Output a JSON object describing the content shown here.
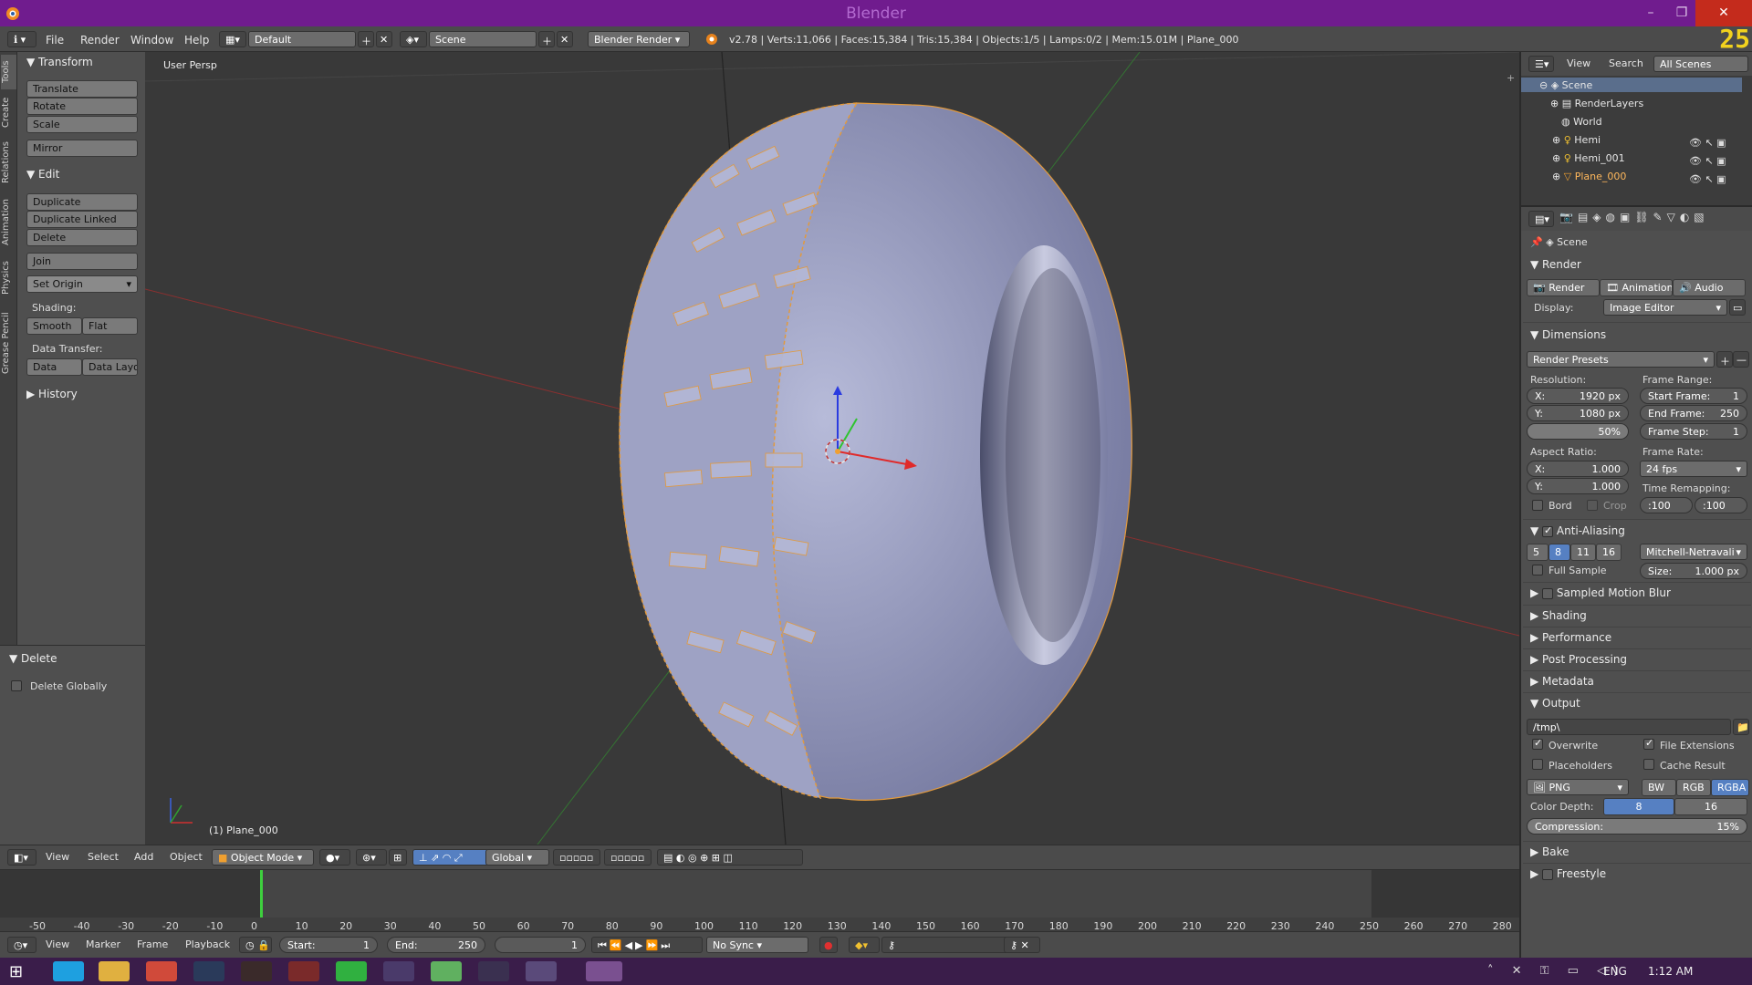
{
  "window": {
    "title": "Blender",
    "minimize": "–",
    "maximize": "❐",
    "close": "✕"
  },
  "info_bar": {
    "menus": [
      "File",
      "Render",
      "Window",
      "Help"
    ],
    "layout": "Default",
    "scene": "Scene",
    "engine": "Blender Render",
    "stats": "v2.78 | Verts:11,066 | Faces:15,384 | Tris:15,384 | Objects:1/5 | Lamps:0/2 | Mem:15.01M | Plane_000"
  },
  "corner_text": "25",
  "left_tabs": [
    "Tools",
    "Create",
    "Relations",
    "Animation",
    "Physics",
    "Grease Pencil"
  ],
  "tool_shelf": {
    "transform": {
      "title": "Transform",
      "buttons": [
        "Translate",
        "Rotate",
        "Scale",
        "Mirror"
      ]
    },
    "edit": {
      "title": "Edit",
      "buttons": [
        "Duplicate",
        "Duplicate Linked",
        "Delete",
        "Join"
      ],
      "set_origin": "Set Origin",
      "shading_label": "Shading:",
      "smooth": "Smooth",
      "flat": "Flat",
      "data_transfer_label": "Data Transfer:",
      "data": "Data",
      "data_layout": "Data Layo"
    },
    "history": "History"
  },
  "operator_panel": {
    "title": "Delete",
    "option": "Delete Globally"
  },
  "viewport": {
    "view_name": "User Persp",
    "object_label": "(1) Plane_000"
  },
  "view3d_header": {
    "menus": [
      "View",
      "Select",
      "Add",
      "Object"
    ],
    "mode": "Object Mode",
    "orientation": "Global"
  },
  "timeline": {
    "ticks": [
      "-50",
      "-40",
      "-30",
      "-20",
      "-10",
      "0",
      "10",
      "20",
      "30",
      "40",
      "50",
      "60",
      "70",
      "80",
      "90",
      "100",
      "110",
      "120",
      "130",
      "140",
      "150",
      "160",
      "170",
      "180",
      "190",
      "200",
      "210",
      "220",
      "230",
      "240",
      "250",
      "260",
      "270",
      "280"
    ],
    "current_frame": 1
  },
  "timeline_header": {
    "menus": [
      "View",
      "Marker",
      "Frame",
      "Playback"
    ],
    "start": "Start:",
    "start_val": "1",
    "end": "End:",
    "end_val": "250",
    "current": "1",
    "sync": "No Sync"
  },
  "outliner": {
    "menus": [
      "View",
      "Search"
    ],
    "filter": "All Scenes",
    "items": [
      "Scene",
      "RenderLayers",
      "World",
      "Hemi",
      "Hemi_001",
      "Plane_000"
    ]
  },
  "properties": {
    "context": "Scene",
    "render": {
      "title": "Render",
      "render_btn": "Render",
      "animation_btn": "Animation",
      "audio_btn": "Audio",
      "display_label": "Display:",
      "display": "Image Editor"
    },
    "dimensions": {
      "title": "Dimensions",
      "presets": "Render Presets",
      "resolution_label": "Resolution:",
      "res_x": "X:",
      "res_x_val": "1920 px",
      "res_y": "Y:",
      "res_y_val": "1080 px",
      "res_pct": "50%",
      "frame_range_label": "Frame Range:",
      "start_frame": "Start Frame:",
      "start_frame_val": "1",
      "end_frame": "End Frame:",
      "end_frame_val": "250",
      "frame_step": "Frame Step:",
      "frame_step_val": "1",
      "aspect_label": "Aspect Ratio:",
      "asp_x": "X:",
      "asp_x_val": "1.000",
      "asp_y": "Y:",
      "asp_y_val": "1.000",
      "frame_rate_label": "Frame Rate:",
      "frame_rate": "24 fps",
      "time_remap_label": "Time Remapping:",
      "remap_old": ":100",
      "remap_new": ":100",
      "border": "Bord",
      "crop": "Crop"
    },
    "anti_aliasing": {
      "title": "Anti-Aliasing",
      "samples": [
        "5",
        "8",
        "11",
        "16"
      ],
      "filter": "Mitchell-Netravali",
      "full_sample": "Full Sample",
      "size": "Size:",
      "size_val": "1.000 px"
    },
    "collapsed": [
      "Sampled Motion Blur",
      "Shading",
      "Performance",
      "Post Processing",
      "Metadata"
    ],
    "output": {
      "title": "Output",
      "path": "/tmp\\",
      "overwrite": "Overwrite",
      "file_ext": "File Extensions",
      "placeholders": "Placeholders",
      "cache": "Cache Result",
      "format": "PNG",
      "bw": "BW",
      "rgb": "RGB",
      "rgba": "RGBA",
      "color_depth_label": "Color Depth:",
      "depth_8": "8",
      "depth_16": "16",
      "compression": "Compression:",
      "compression_val": "15%"
    },
    "bake": "Bake",
    "freestyle": "Freestyle"
  },
  "taskbar": {
    "lang": "ENG",
    "time": "1:12 AM"
  },
  "colors": {
    "title_purple": "#701c8e",
    "accent_blue": "#5680c2",
    "tire": "#8f93ba",
    "edge_orange": "#e39a3c"
  }
}
